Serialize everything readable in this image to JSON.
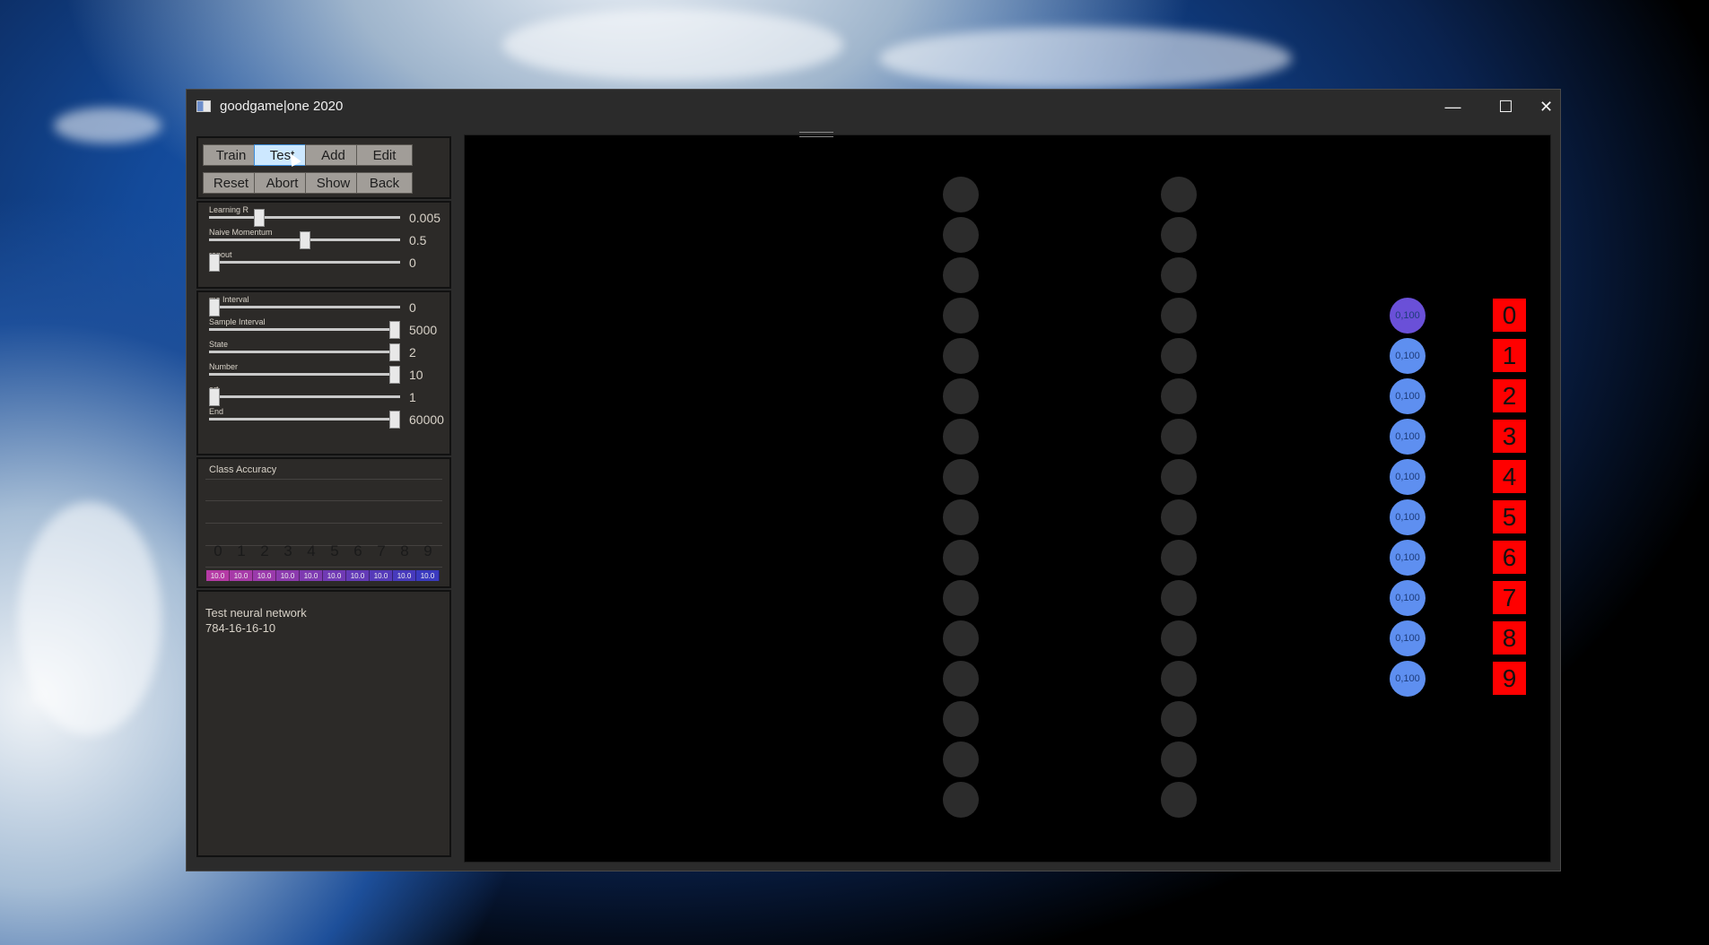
{
  "window": {
    "title": "goodgame|one 2020",
    "controls": {
      "minimize": "—",
      "maximize": "☐",
      "close": "✕"
    }
  },
  "buttons": [
    {
      "label": "Train",
      "active": false
    },
    {
      "label": "Test",
      "active": true
    },
    {
      "label": "Add",
      "active": false
    },
    {
      "label": "Edit",
      "active": false
    },
    {
      "label": "Reset",
      "active": false
    },
    {
      "label": "Abort",
      "active": false
    },
    {
      "label": "Show",
      "active": false
    },
    {
      "label": "Back",
      "active": false
    }
  ],
  "hyperparams": [
    {
      "label": "Learning R",
      "value": "0.005",
      "level": 0.25
    },
    {
      "label": "Naive Momentum",
      "value": "0.5",
      "level": 0.5
    },
    {
      "label": "ropout",
      "value": "0",
      "level": 0
    }
  ],
  "run_settings": [
    {
      "label": "me Interval",
      "value": "0",
      "level": 0
    },
    {
      "label": "Sample Interval",
      "value": "5000",
      "level": 1
    },
    {
      "label": "State",
      "value": "2",
      "level": 1
    },
    {
      "label": "Number",
      "value": "10",
      "level": 1
    },
    {
      "label": "art",
      "value": "1",
      "level": 0
    },
    {
      "label": "End",
      "value": "60000",
      "level": 1
    }
  ],
  "class_accuracy": {
    "title": "Class Accuracy",
    "digits": [
      "0",
      "1",
      "2",
      "3",
      "4",
      "5",
      "6",
      "7",
      "8",
      "9"
    ],
    "values": [
      "10.0",
      "10.0",
      "10.0",
      "10.0",
      "10.0",
      "10.0",
      "10.0",
      "10.0",
      "10.0",
      "10.0"
    ],
    "colors": [
      "#b53aa5",
      "#a73aa8",
      "#9a3aab",
      "#8c3aae",
      "#7e3ab1",
      "#703ab4",
      "#633ab7",
      "#553ab9",
      "#473abc",
      "#3a3abf"
    ]
  },
  "info": {
    "line1": "Test neural network",
    "line2": "784-16-16-10"
  },
  "network": {
    "hidden1_count": 16,
    "hidden2_count": 16,
    "output_values": [
      "0,100",
      "0,100",
      "0,100",
      "0,100",
      "0,100",
      "0,100",
      "0,100",
      "0,100",
      "0,100",
      "0,100"
    ],
    "output_labels": [
      "0",
      "1",
      "2",
      "3",
      "4",
      "5",
      "6",
      "7",
      "8",
      "9"
    ],
    "colors": {
      "hidden_node": "#2c2c2c",
      "output_node": "#5e8ff0",
      "output_node_first": "#6a50d8",
      "label_box": "#ff0000"
    }
  }
}
